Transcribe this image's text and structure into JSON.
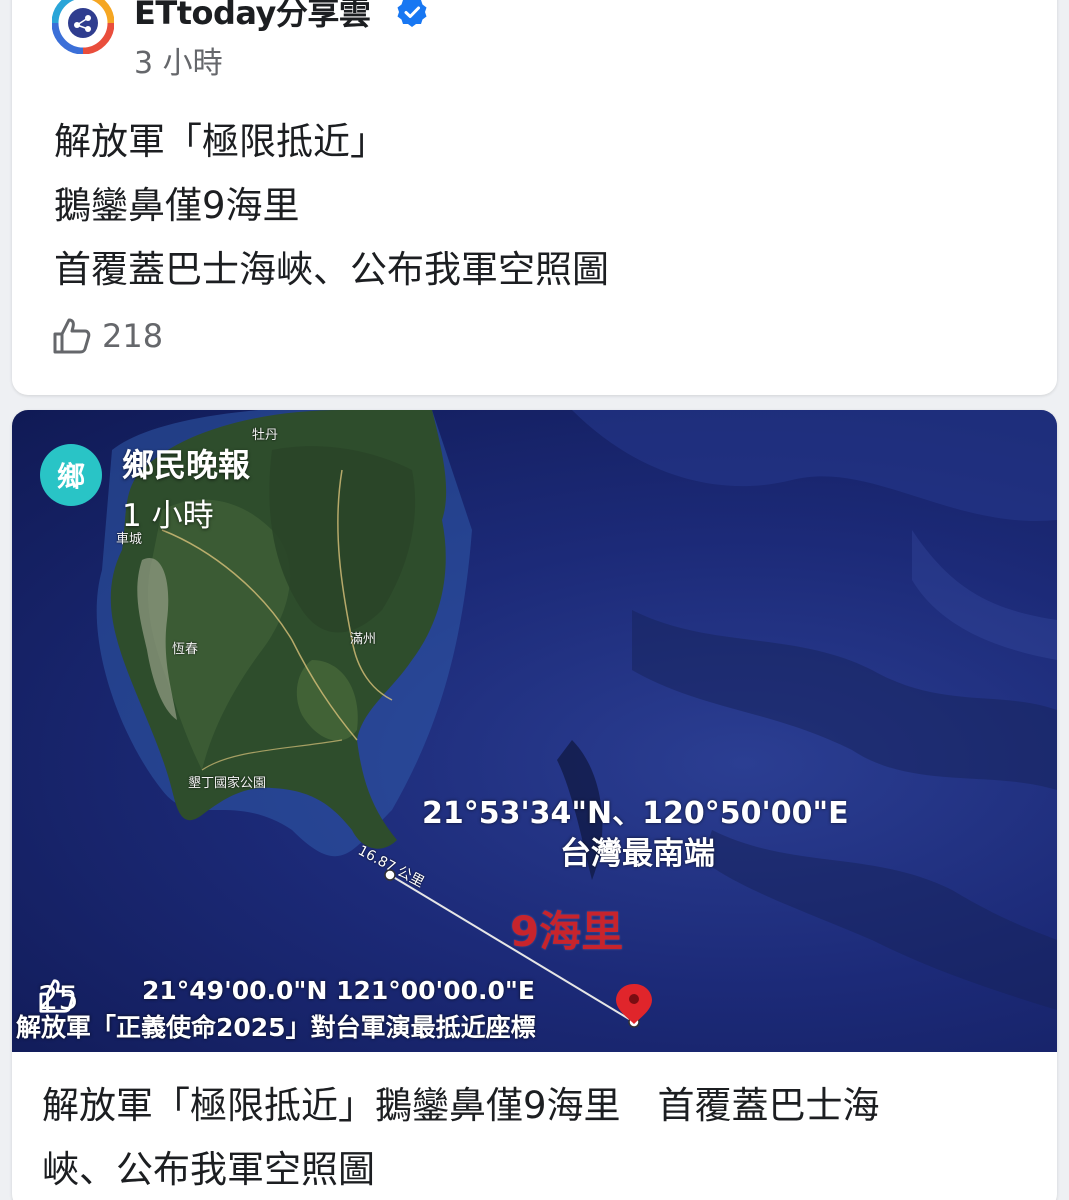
{
  "post1": {
    "author": "ETtoday分享雲",
    "verified_icon": "verified-badge-icon",
    "time": "3 小時",
    "text_lines": [
      "解放軍「極限抵近」",
      "鵝鑾鼻僅9海里",
      "首覆蓋巴士海峽、公布我軍空照圖"
    ],
    "likes": "218",
    "colors": {
      "verified": "#1877f2",
      "avatar_ring": "#f5a623"
    }
  },
  "post2": {
    "overlay_author": "鄉民晚報",
    "avatar_char": "鄉",
    "overlay_time": "1 小時",
    "overlay_likes": "25",
    "map": {
      "place_labels": [
        "牡丹",
        "車城",
        "滿州",
        "恆春",
        "墾丁國家公園"
      ],
      "southern_tip_coord": "21°53'34\"N、120°50'00\"E",
      "southern_tip_label": "台灣最南端",
      "distance_km": "16.87 公里",
      "distance_nm": "9海里",
      "pla_coord": "21°49'00.0\"N 121°00'00.0\"E",
      "caption": "解放軍「正義使命2025」對台軍演最抵近座標"
    },
    "link_title_lines": [
      "解放軍「極限抵近」鵝鑾鼻僅9海里　首覆蓋巴士海",
      "峽、公布我軍空照圖"
    ],
    "colors": {
      "avatar": "#29c4c6",
      "distance": "#c8242c",
      "marker": "#e0252b"
    }
  }
}
